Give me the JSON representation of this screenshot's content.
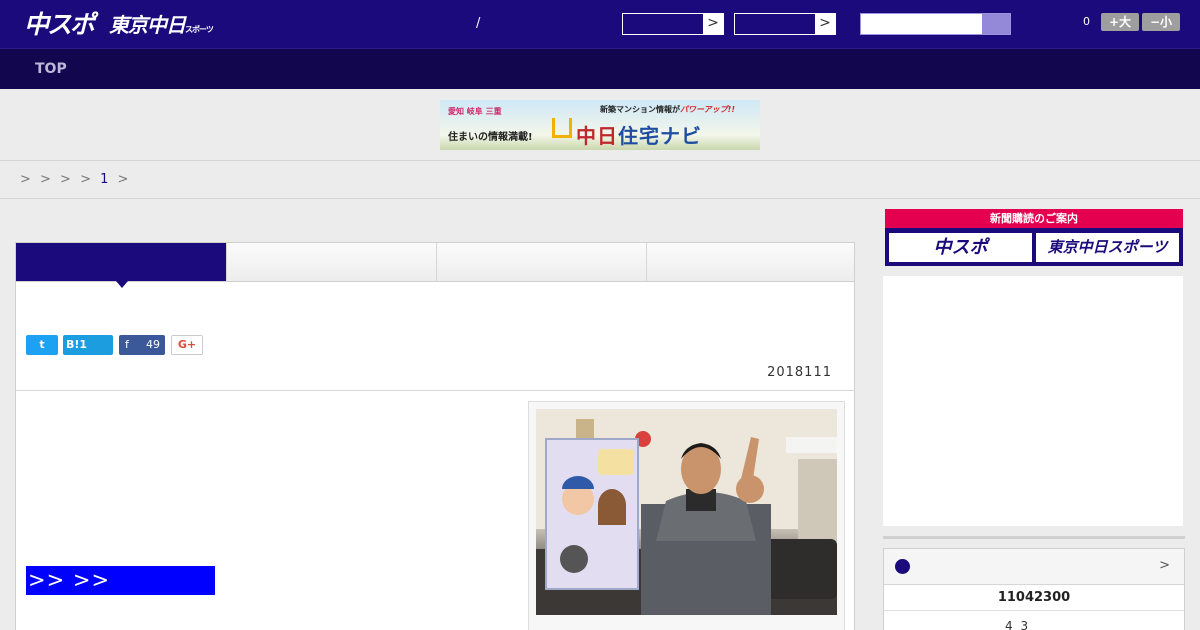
{
  "header": {
    "logo_main": "中スポ",
    "logo_sub": "東京中日",
    "logo_sub_small": "スポーツ",
    "slash": "/",
    "select_arrow": ">",
    "count": "0",
    "font_larger": "+大",
    "font_smaller": "−小"
  },
  "nav": {
    "top_label": "TOP"
  },
  "banner": {
    "tags": "愛知 岐阜 三重",
    "tagline": "住まいの情報満載!",
    "headline_prefix": "新築マンション情報が",
    "headline_emph": "パワーアップ!!",
    "brand_red": "中日",
    "brand_blue": "住宅ナビ"
  },
  "breadcrumb": {
    "arrows": "> > > >",
    "page": "1",
    "tail": ">"
  },
  "article": {
    "share": {
      "twitter": "t",
      "hatena": "B!1",
      "facebook_icon": "f",
      "facebook_count": "49",
      "gplus": "G+"
    },
    "date": "2018111",
    "related_link": ">> >>"
  },
  "sidebar": {
    "subscribe_title": "新聞購読のご案内",
    "sub_chunichi": "中スポ",
    "sub_tokyo": "東京中日スポーツ",
    "score_more": ">",
    "score_line": "11042300",
    "score_sub": "4 3"
  },
  "colors": {
    "brand": "#1a0a7c",
    "nav": "#12064f",
    "accent": "#e5004f",
    "link_bg": "#0000ff"
  }
}
